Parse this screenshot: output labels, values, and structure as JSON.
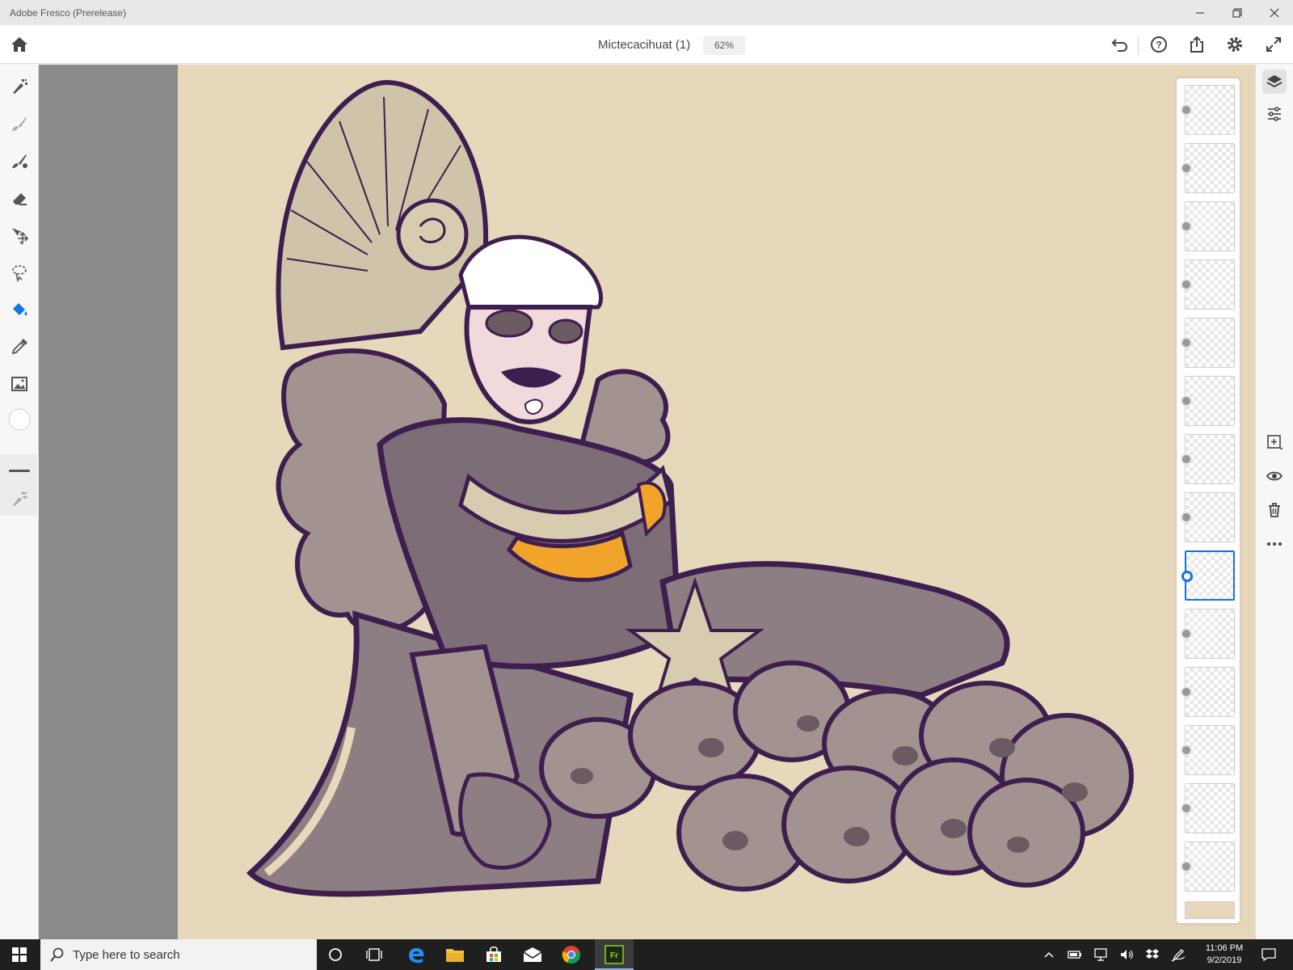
{
  "window": {
    "title": "Adobe Fresco (Prerelease)",
    "controls": [
      "minimize-icon",
      "restore-icon",
      "close-icon"
    ]
  },
  "header": {
    "document_title": "Mictecacihuat (1)",
    "zoom": "62%"
  },
  "toolbar": {
    "tools": [
      "pixel-brush-icon",
      "live-brush-icon",
      "vector-brush-icon",
      "eraser-icon",
      "transform-icon",
      "lasso-icon",
      "fill-icon",
      "eyedropper-icon",
      "image-icon",
      "color-swatch",
      "brush-size-slider",
      "brush-settings-icon"
    ],
    "active_tool": "fill-icon",
    "accent_color": "#1473e6"
  },
  "canvas": {
    "background_color": "#e7d7bb",
    "artwork_subject": "Mictecacihuatl illustration"
  },
  "layers": {
    "count": 14,
    "selected_index": 8
  },
  "taskbar": {
    "search_placeholder": "Type here to search",
    "time": "11:06 PM",
    "date": "9/2/2019"
  }
}
